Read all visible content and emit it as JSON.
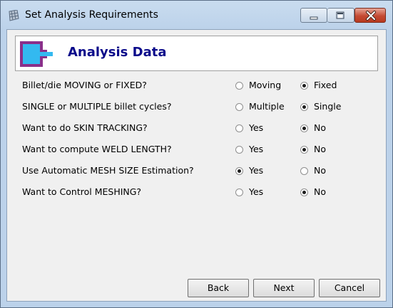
{
  "window": {
    "title": "Set Analysis Requirements",
    "icons": {
      "app": "grid-window-icon",
      "minimize": "minimize-icon",
      "maximize": "maximize-icon",
      "close": "close-icon"
    }
  },
  "header": {
    "title": "Analysis Data",
    "icon": "billet-die-icon"
  },
  "questions": [
    {
      "label": "Billet/die MOVING or FIXED?",
      "options": [
        {
          "label": "Moving",
          "selected": false
        },
        {
          "label": "Fixed",
          "selected": true
        }
      ]
    },
    {
      "label": "SINGLE or MULTIPLE billet cycles?",
      "options": [
        {
          "label": "Multiple",
          "selected": false
        },
        {
          "label": "Single",
          "selected": true
        }
      ]
    },
    {
      "label": "Want to do SKIN TRACKING?",
      "options": [
        {
          "label": "Yes",
          "selected": false
        },
        {
          "label": "No",
          "selected": true
        }
      ]
    },
    {
      "label": "Want to compute WELD LENGTH?",
      "options": [
        {
          "label": "Yes",
          "selected": false
        },
        {
          "label": "No",
          "selected": true
        }
      ]
    },
    {
      "label": "Use Automatic MESH SIZE Estimation?",
      "options": [
        {
          "label": "Yes",
          "selected": true
        },
        {
          "label": "No",
          "selected": false
        }
      ]
    },
    {
      "label": "Want to Control MESHING?",
      "options": [
        {
          "label": "Yes",
          "selected": false
        },
        {
          "label": "No",
          "selected": true
        }
      ]
    }
  ],
  "buttons": {
    "back": "Back",
    "next": "Next",
    "cancel": "Cancel"
  },
  "colors": {
    "header_title": "#0a0a8a",
    "close_button": "#c44a33",
    "icon_body": "#33b9f0",
    "icon_frame": "#8a2f8a"
  }
}
